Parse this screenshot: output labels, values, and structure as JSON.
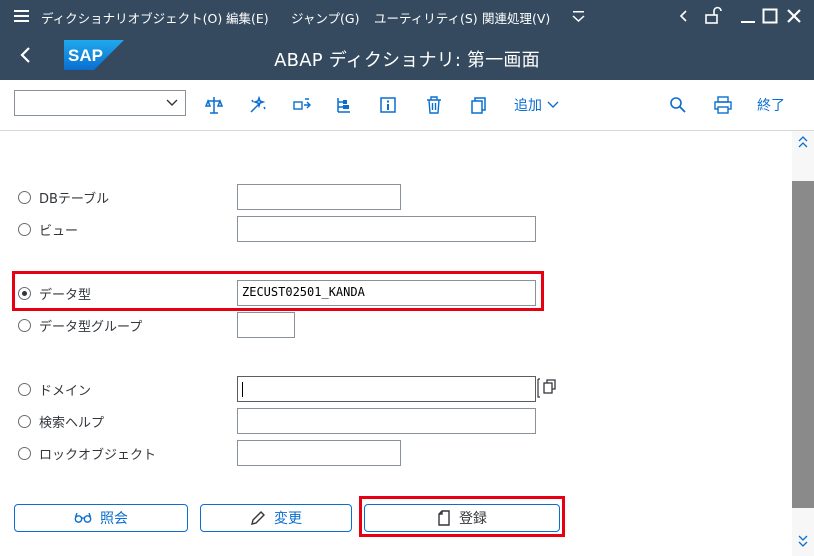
{
  "menu": {
    "items": [
      "ディクショナリオブジェクト(O)",
      "編集(E)",
      "ジャンプ(G)",
      "ユーティリティ(S)",
      "関連処理(V)"
    ]
  },
  "header": {
    "title": "ABAP ディクショナリ: 第一画面"
  },
  "toolbar": {
    "add_label": "追加",
    "exit_label": "終了",
    "command_value": ""
  },
  "form": {
    "options": [
      {
        "label": "DBテーブル",
        "value": "",
        "selected": false
      },
      {
        "label": "ビュー",
        "value": "",
        "selected": false
      },
      {
        "label": "データ型",
        "value": "ZECUST02501_KANDA",
        "selected": true
      },
      {
        "label": "データ型グループ",
        "value": "",
        "selected": false
      },
      {
        "label": "ドメイン",
        "value": "",
        "selected": false
      },
      {
        "label": "検索ヘルプ",
        "value": "",
        "selected": false
      },
      {
        "label": "ロックオブジェクト",
        "value": "",
        "selected": false
      }
    ]
  },
  "buttons": {
    "display": "照会",
    "change": "変更",
    "create": "登録"
  },
  "colors": {
    "shell": "#354a5f",
    "accent": "#0a6ed1",
    "highlight": "#e60012"
  }
}
